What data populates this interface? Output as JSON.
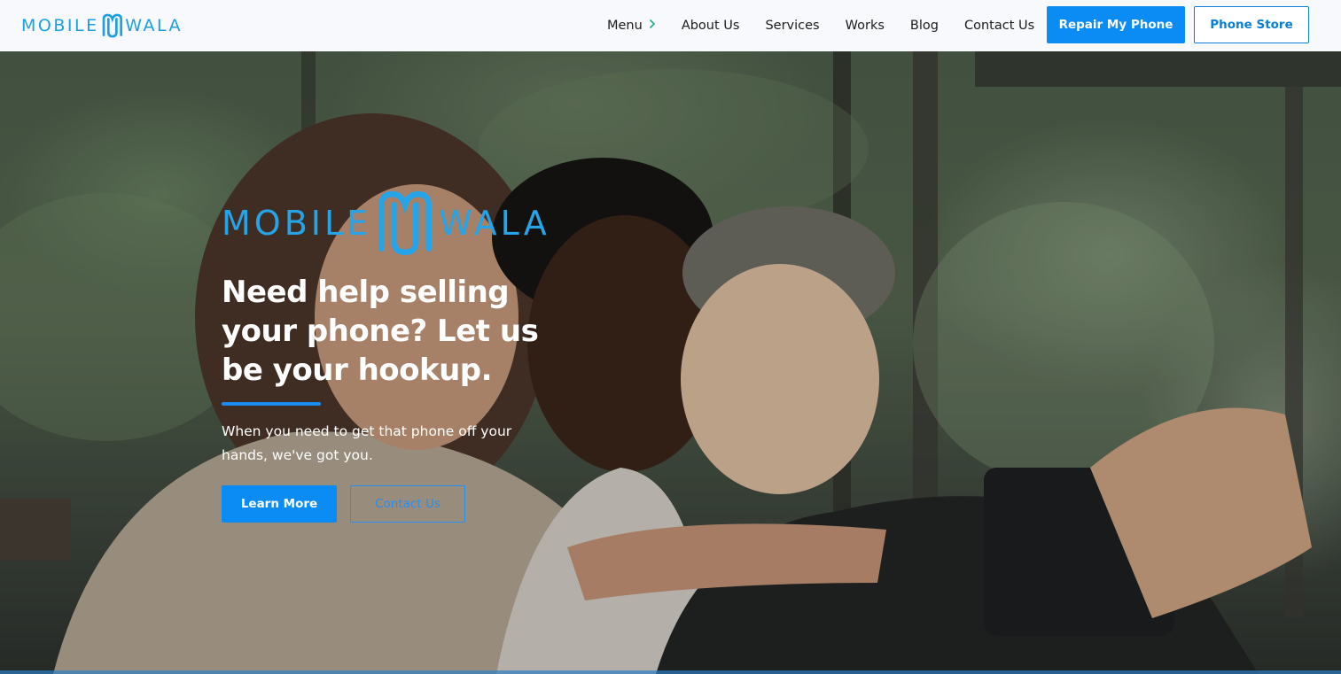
{
  "brand": {
    "logo_left": "MOBILE",
    "logo_right": "WALA",
    "color": "#1b9fe0"
  },
  "nav": {
    "items": [
      {
        "label": "Menu",
        "icon": "chevron-right-icon"
      },
      {
        "label": "About Us"
      },
      {
        "label": "Services"
      },
      {
        "label": "Works"
      },
      {
        "label": "Blog"
      },
      {
        "label": "Contact Us"
      }
    ],
    "repair_button": "Repair My Phone",
    "store_button": "Phone Store"
  },
  "hero": {
    "logo_left": "MOBILE",
    "logo_right": "WALA",
    "title": "Need help selling your phone? Let us be your hookup.",
    "subtitle": "When you need to get that phone off your hands, we've got you.",
    "learn_more": "Learn More",
    "contact_us": "Contact Us",
    "accent_color": "#0b8cf5"
  }
}
